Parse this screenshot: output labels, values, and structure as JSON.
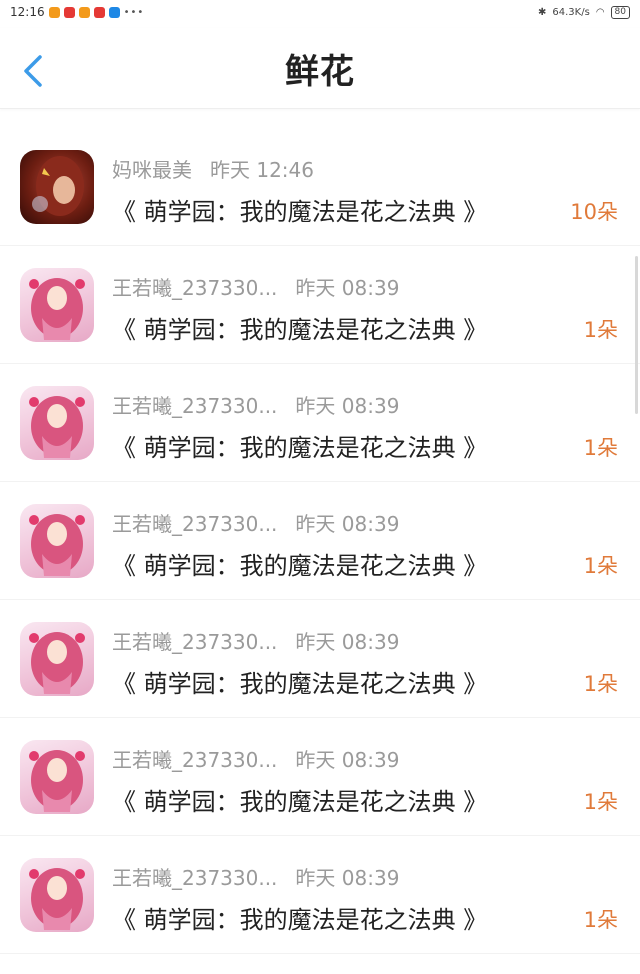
{
  "status_bar": {
    "time": "12:16",
    "dots": "•••",
    "network_speed": "64.3K/s",
    "battery": "80",
    "icon_colors": [
      "#f39a1b",
      "#e53935",
      "#f39a1b",
      "#e53935",
      "#1e88e5"
    ]
  },
  "nav": {
    "title": "鲜花",
    "back_icon": "chevron-left-icon",
    "accent_color": "#3c9be8"
  },
  "items": [
    {
      "user": "妈咪最美",
      "time": "昨天 12:46",
      "book": "《 萌学园：我的魔法是花之法典 》",
      "count": "10朵",
      "avatar": "mom"
    },
    {
      "user": "王若曦_237330...",
      "time": "昨天 08:39",
      "book": "《 萌学园：我的魔法是花之法典 》",
      "count": "1朵",
      "avatar": "girl"
    },
    {
      "user": "王若曦_237330...",
      "time": "昨天 08:39",
      "book": "《 萌学园：我的魔法是花之法典 》",
      "count": "1朵",
      "avatar": "girl"
    },
    {
      "user": "王若曦_237330...",
      "time": "昨天 08:39",
      "book": "《 萌学园：我的魔法是花之法典 》",
      "count": "1朵",
      "avatar": "girl"
    },
    {
      "user": "王若曦_237330...",
      "time": "昨天 08:39",
      "book": "《 萌学园：我的魔法是花之法典 》",
      "count": "1朵",
      "avatar": "girl"
    },
    {
      "user": "王若曦_237330...",
      "time": "昨天 08:39",
      "book": "《 萌学园：我的魔法是花之法典 》",
      "count": "1朵",
      "avatar": "girl"
    },
    {
      "user": "王若曦_237330...",
      "time": "昨天 08:39",
      "book": "《 萌学园：我的魔法是花之法典 》",
      "count": "1朵",
      "avatar": "girl"
    }
  ]
}
